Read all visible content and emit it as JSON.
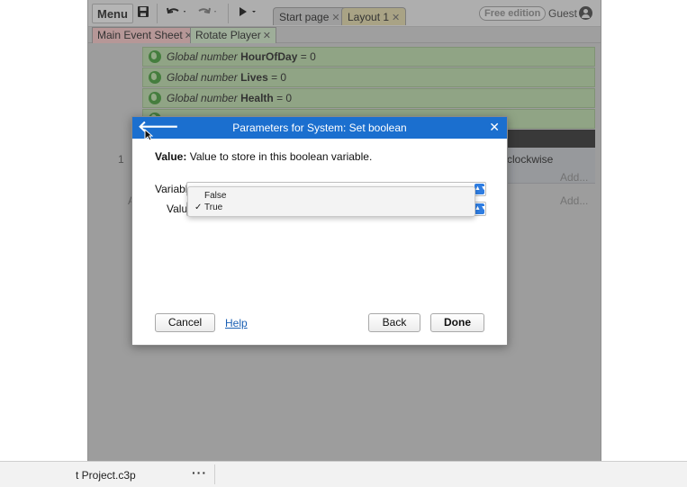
{
  "toolbar": {
    "menu_label": "Menu",
    "save_icon": "save-icon",
    "undo_icon": "undo-icon",
    "redo_icon": "redo-icon",
    "play_icon": "play-icon",
    "tabs": [
      {
        "label": "Start page"
      },
      {
        "label": "Layout 1"
      }
    ],
    "free_edition_label": "Free edition",
    "guest_label": "Guest"
  },
  "sheet_tabs": [
    {
      "label": "Main Event Sheet"
    },
    {
      "label": "Rotate Player"
    }
  ],
  "event_sheet": {
    "globals": [
      {
        "prefix": "Global number",
        "name": "HourOfDay",
        "suffix": "= 0"
      },
      {
        "prefix": "Global number",
        "name": "Lives",
        "suffix": "= 0"
      },
      {
        "prefix": "Global number",
        "name": "Health",
        "suffix": "= 0"
      }
    ],
    "event_number": "1",
    "partial_letter": "A",
    "action_text": "clockwise",
    "add_label": "Add..."
  },
  "dialog": {
    "title": "Parameters for System: Set boolean",
    "description_label": "Value:",
    "description_text": "Value to store in this boolean variable.",
    "variable_label": "Variable:",
    "value_label": "Value:",
    "dropdown_options": [
      {
        "label": "False",
        "selected": false
      },
      {
        "label": "True",
        "selected": true
      }
    ],
    "check_mark": "✓",
    "cancel_label": "Cancel",
    "help_label": "Help",
    "back_label": "Back",
    "done_label": "Done",
    "accent_color": "#1b6fcf"
  },
  "status": {
    "project_name": "t Project.c3p",
    "more_label": "···"
  }
}
